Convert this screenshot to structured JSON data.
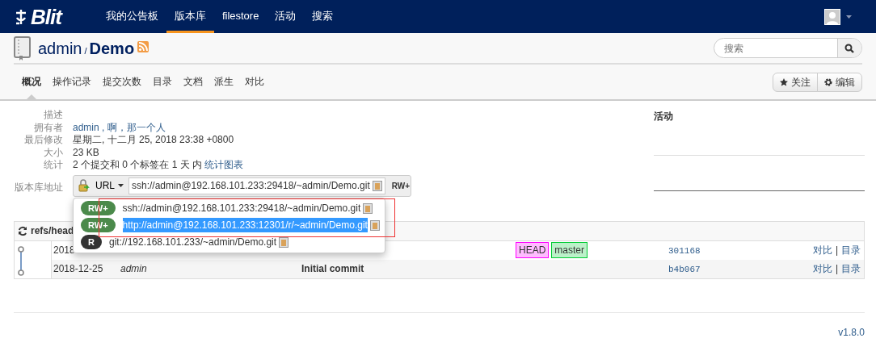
{
  "navbar": {
    "logo": "Blit",
    "items": [
      {
        "label": "我的公告板",
        "selected": false
      },
      {
        "label": "版本库",
        "selected": true
      },
      {
        "label": "filestore",
        "selected": false
      },
      {
        "label": "活动",
        "selected": false
      },
      {
        "label": "搜索",
        "selected": false
      }
    ]
  },
  "repo": {
    "owner": "admin",
    "separator": "/",
    "name": "Demo"
  },
  "search": {
    "placeholder": "搜索"
  },
  "tabs": [
    {
      "label": "概况",
      "selected": true
    },
    {
      "label": "操作记录",
      "selected": false
    },
    {
      "label": "提交次数",
      "selected": false
    },
    {
      "label": "目录",
      "selected": false
    },
    {
      "label": "文档",
      "selected": false
    },
    {
      "label": "派生",
      "selected": false
    },
    {
      "label": "对比",
      "selected": false
    }
  ],
  "actions": [
    {
      "kind": "star",
      "label": "关注"
    },
    {
      "kind": "gear",
      "label": "编辑"
    }
  ],
  "summary": [
    {
      "label": "描述"
    },
    {
      "label": "拥有者",
      "parts": [
        {
          "text": "admin , 啊，那一个人",
          "link": true
        }
      ]
    },
    {
      "label": "最后修改",
      "parts": [
        {
          "text": "星期二, 十二月 25, 2018 23:38 +0800",
          "link": false
        }
      ]
    },
    {
      "label": "大小",
      "parts": [
        {
          "text": "23 KB",
          "link": false
        }
      ]
    },
    {
      "label": "统计",
      "parts": [
        {
          "text": "2 个提交和 0 个标签在 1 天 内",
          "link": false
        },
        {
          "text": "统计图表",
          "link": true
        }
      ]
    }
  ],
  "repo_url": {
    "label": "版本库地址",
    "protocol": "URL",
    "url": "ssh://admin@192.168.101.233:29418/~admin/Demo.git",
    "permission": "RW+"
  },
  "url_menu": [
    {
      "permission": "RW+",
      "color": "#4b8a4b",
      "url": "ssh://admin@192.168.101.233:29418/~admin/Demo.git",
      "selected": false
    },
    {
      "permission": "RW+",
      "color": "#4b8a4b",
      "url": "http://admin@192.168.101.233:12301/r/~admin/Demo.git",
      "selected": true
    },
    {
      "permission": "R",
      "color": "#333333",
      "url": "git://192.168.101.233/~admin/Demo.git",
      "selected": false
    }
  ],
  "activity": {
    "title": "活动"
  },
  "commits": {
    "header": "refs/head",
    "rows": [
      {
        "date": "2018",
        "refs": [
          {
            "label": "HEAD",
            "color": "#ff00ff"
          },
          {
            "label": "master",
            "color": "#00cc33"
          }
        ],
        "sha": "301168",
        "actions": [
          "对比",
          "目录"
        ],
        "separator": "|"
      },
      {
        "date": "2018-12-25",
        "author": "admin",
        "message": "Initial commit",
        "refs": [],
        "sha": "b4b067",
        "actions": [
          "对比",
          "目录"
        ],
        "separator": "|"
      }
    ]
  },
  "footer": {
    "version": "v1.8.0"
  }
}
